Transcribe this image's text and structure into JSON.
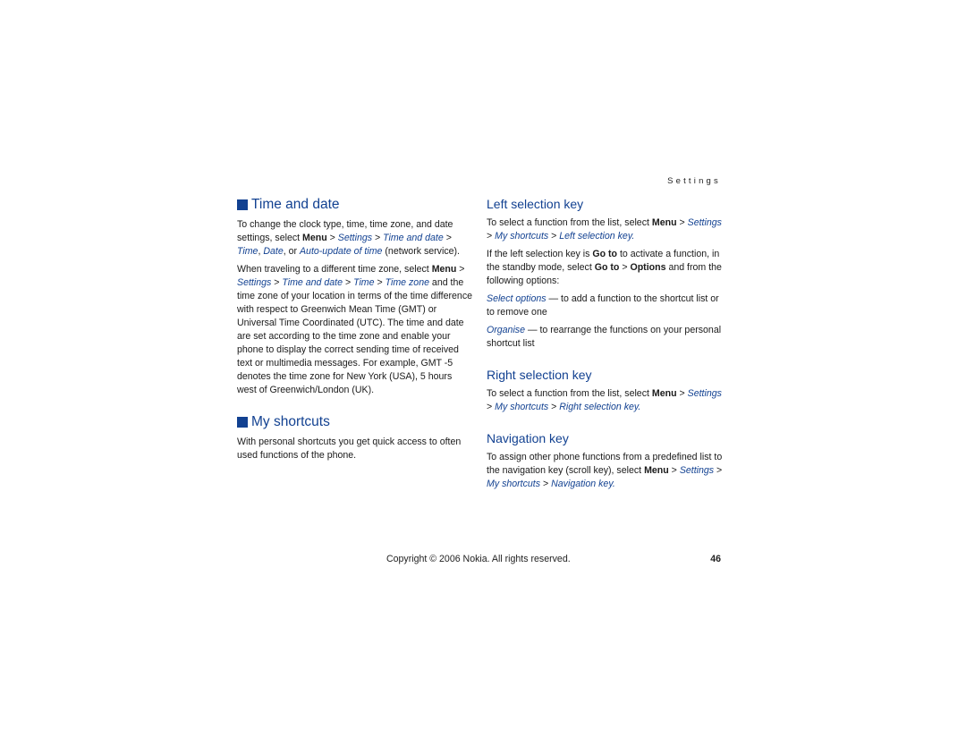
{
  "running_header": "Settings",
  "left_column": {
    "time_and_date": {
      "heading": "Time and date",
      "p1": {
        "t1": "To change the clock type, time, time zone, and date settings, select ",
        "menu": "Menu",
        "sep1": " > ",
        "settings": "Settings",
        "sep2": " > ",
        "time_and_date": "Time and date",
        "sep3": " > ",
        "time": "Time",
        "comma": ", ",
        "date": "Date",
        "or": ", or ",
        "auto_update": "Auto-update of time",
        "tail": " (network service)."
      },
      "p2": {
        "t1": "When traveling to a different time zone, select ",
        "menu": "Menu",
        "sep1": " > ",
        "settings": "Settings",
        "sep2": " > ",
        "time_and_date": "Time and date",
        "sep3": " > ",
        "time": "Time",
        "sep4": " > ",
        "time_zone": "Time zone",
        "tail": " and the time zone of your location in terms of the time difference with respect to Greenwich Mean Time (GMT) or Universal Time Coordinated (UTC). The time and date are set according to the time zone and enable your phone to display the correct sending time of received text or multimedia messages. For example, GMT -5 denotes the time zone for New York (USA), 5 hours west of Greenwich/London (UK)."
      }
    },
    "my_shortcuts": {
      "heading": "My shortcuts",
      "p1": "With personal shortcuts you get quick access to often used functions of the phone."
    }
  },
  "right_column": {
    "left_selection_key": {
      "heading": "Left selection key",
      "p1": {
        "t1": "To select a function from the list, select ",
        "menu": "Menu",
        "sep1": " > ",
        "settings": "Settings",
        "sep2": " > ",
        "my_shortcuts": "My shortcuts",
        "sep3": " > ",
        "target": "Left selection key",
        "end": "."
      },
      "p2": {
        "t1": "If the left selection key is ",
        "go_to": "Go to",
        "t2": " to activate a function, in the standby mode, select ",
        "go_to_2": "Go to",
        "sep": " > ",
        "options": "Options",
        "t3": " and from the following options:"
      },
      "options_list": [
        {
          "name": "Select options",
          "desc": " — to add a function to the shortcut list or to remove one"
        },
        {
          "name": "Organise",
          "desc": " — to rearrange the functions on your personal shortcut list"
        }
      ]
    },
    "right_selection_key": {
      "heading": "Right selection key",
      "p1": {
        "t1": "To select a function from the list, select ",
        "menu": "Menu",
        "sep1": " > ",
        "settings": "Settings",
        "sep2": " > ",
        "my_shortcuts": "My shortcuts",
        "sep3": " > ",
        "target": "Right selection key",
        "end": "."
      }
    },
    "navigation_key": {
      "heading": "Navigation key",
      "p1": {
        "t1": "To assign other phone functions from a predefined list to the navigation key (scroll key), select ",
        "menu": "Menu",
        "sep1": " > ",
        "settings": "Settings",
        "sep2": " > ",
        "my_shortcuts": "My shortcuts",
        "sep3": " > ",
        "target": "Navigation key",
        "end": "."
      }
    }
  },
  "footer": {
    "copyright": "Copyright © 2006 Nokia. All rights reserved.",
    "page_number": "46"
  },
  "colors": {
    "heading_blue": "#124191",
    "text": "#1a1a1a"
  }
}
